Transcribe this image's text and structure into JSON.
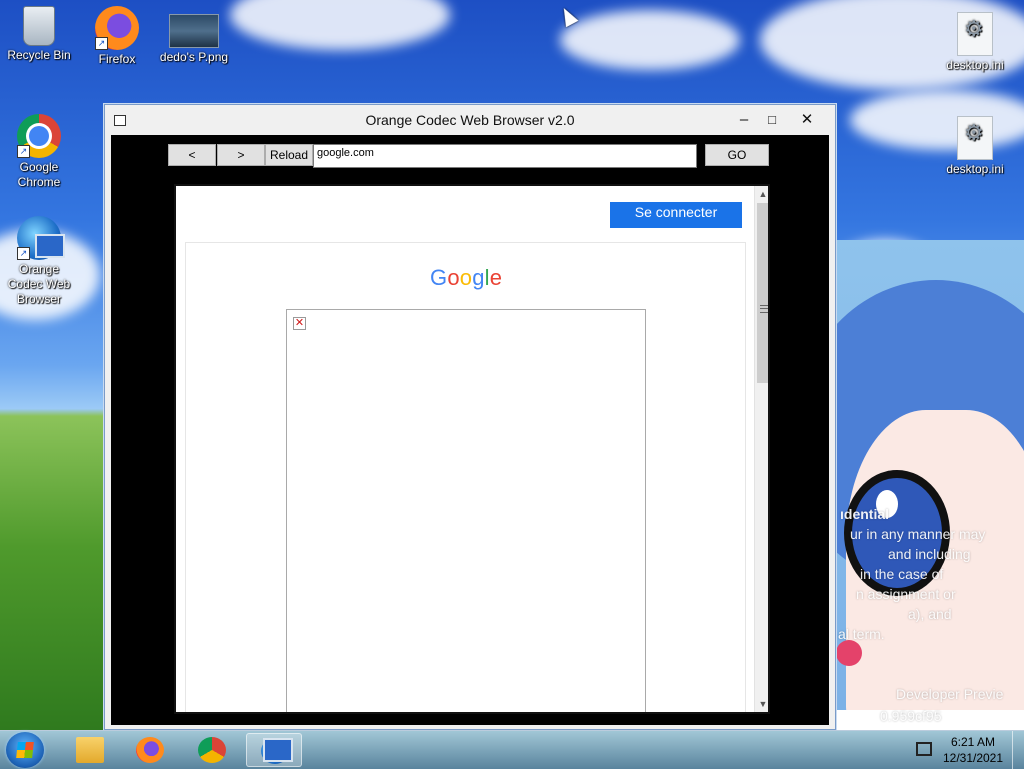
{
  "desktop": {
    "icons_left": [
      {
        "label": "Recycle Bin"
      },
      {
        "label": "Firefox"
      },
      {
        "label": "dedo's P.png"
      },
      {
        "label": "Google Chrome"
      },
      {
        "label": "Orange Codec Web Browser"
      }
    ],
    "icons_right": [
      {
        "label": "desktop.ini"
      },
      {
        "label": "desktop.ini"
      }
    ],
    "watermark_lines": [
      "ıdential",
      "ur in any manner may",
      "and including",
      "in the case of",
      "n assignment or",
      "a), and",
      "al term.",
      "Developer Previe",
      "0.959cf95"
    ]
  },
  "window": {
    "title": "Orange Codec Web Browser v2.0",
    "minimize": "‒",
    "maximize": "□",
    "close": "✕",
    "toolbar": {
      "back_label": "<",
      "forward_label": ">",
      "reload_label": "Reload",
      "url_value": "google.com",
      "go_label": "GO"
    },
    "page": {
      "signin_label": "Se connecter",
      "logo_letters": [
        "G",
        "o",
        "o",
        "g",
        "l",
        "e"
      ],
      "broken_image_glyph": "✕"
    }
  },
  "taskbar": {
    "items": [
      "File Explorer",
      "Firefox",
      "Google Chrome",
      "Orange Codec Web Browser"
    ],
    "active_item": "Orange Codec Web Browser",
    "time": "6:21 AM",
    "date": "12/31/2021"
  },
  "colors": {
    "signin_button": "#1a73e8",
    "browser_client_bg": "#000000"
  }
}
